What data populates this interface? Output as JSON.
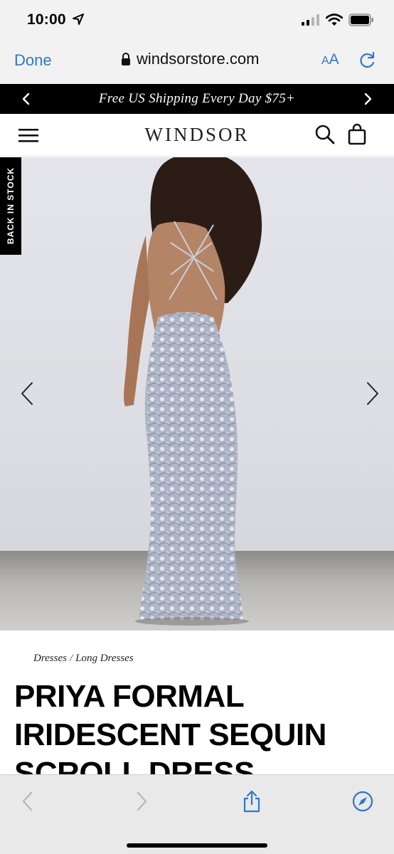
{
  "status_bar": {
    "time": "10:00",
    "icons": [
      "location-arrow-icon",
      "cellular-signal-icon",
      "wifi-icon",
      "battery-icon"
    ]
  },
  "browser": {
    "done_label": "Done",
    "url": "windsorstore.com",
    "text_size_label_small": "A",
    "text_size_label_large": "A"
  },
  "promo": {
    "text": "Free US Shipping Every Day $75+"
  },
  "header": {
    "logo": "WINDSOR"
  },
  "product": {
    "badge": "BACK IN STOCK",
    "breadcrumb": [
      "Dresses",
      "Long Dresses"
    ],
    "breadcrumb_separator": "/",
    "title": "PRIYA FORMAL IRIDESCENT SEQUIN SCROLL DRESS"
  },
  "colors": {
    "safari_blue": "#2a78d4",
    "promo_bg": "#000000",
    "toolbar_bg": "#e9e9ea"
  }
}
